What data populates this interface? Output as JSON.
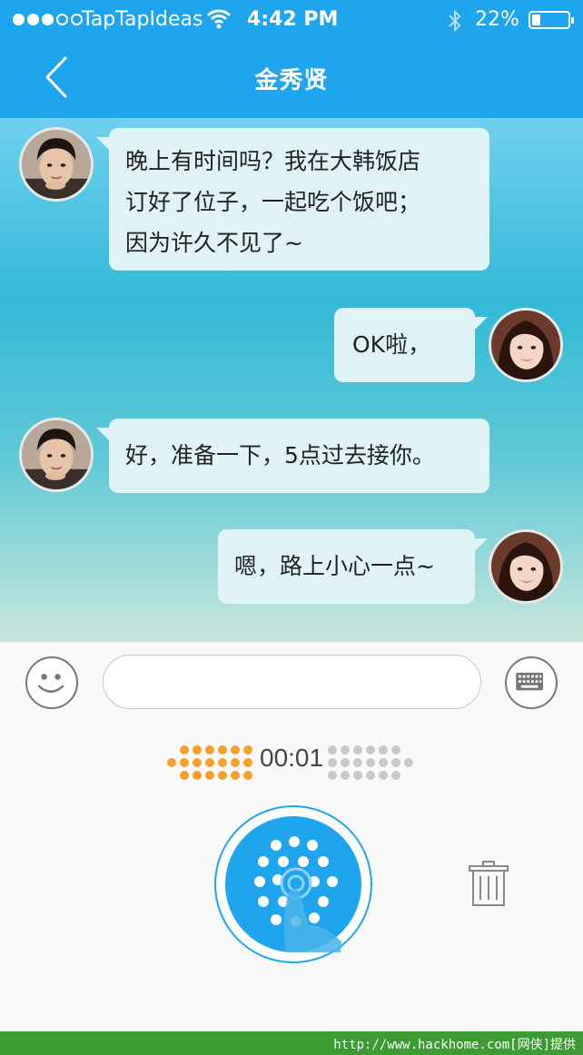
{
  "status_bar": {
    "carrier": "TapTapIdeas",
    "time": "4:42 PM",
    "battery": "22%",
    "signal_bars_filled": 3,
    "signal_bars_total": 5
  },
  "nav": {
    "title": "金秀贤",
    "back_icon": "chevron-left-icon"
  },
  "messages": [
    {
      "side": "left",
      "sender": "金秀贤",
      "lines": [
        "晚上有时间吗？我在大韩饭店",
        "订好了位子，一起吃个饭吧；",
        "因为许久不见了~"
      ]
    },
    {
      "side": "right",
      "sender": "me",
      "lines": [
        "OK啦，"
      ]
    },
    {
      "side": "left",
      "sender": "金秀贤",
      "lines": [
        "好，准备一下，5点过去接你。"
      ]
    },
    {
      "side": "right",
      "sender": "me",
      "lines": [
        "嗯，路上小心一点~"
      ]
    }
  ],
  "input": {
    "value": "",
    "emoji_icon": "smiley-icon",
    "keyboard_icon": "keyboard-icon"
  },
  "voice": {
    "timer": "00:01",
    "record_icon": "microphone-dots-icon",
    "delete_icon": "trash-icon"
  },
  "watermark": "http://www.hackhome.com[网侠]提供",
  "colors": {
    "accent": "#1ea5ee",
    "meter_active": "#f7a12b",
    "meter_inactive": "#c8c8c8",
    "bubble": "#dff3f6",
    "footer": "#3c9b33"
  }
}
